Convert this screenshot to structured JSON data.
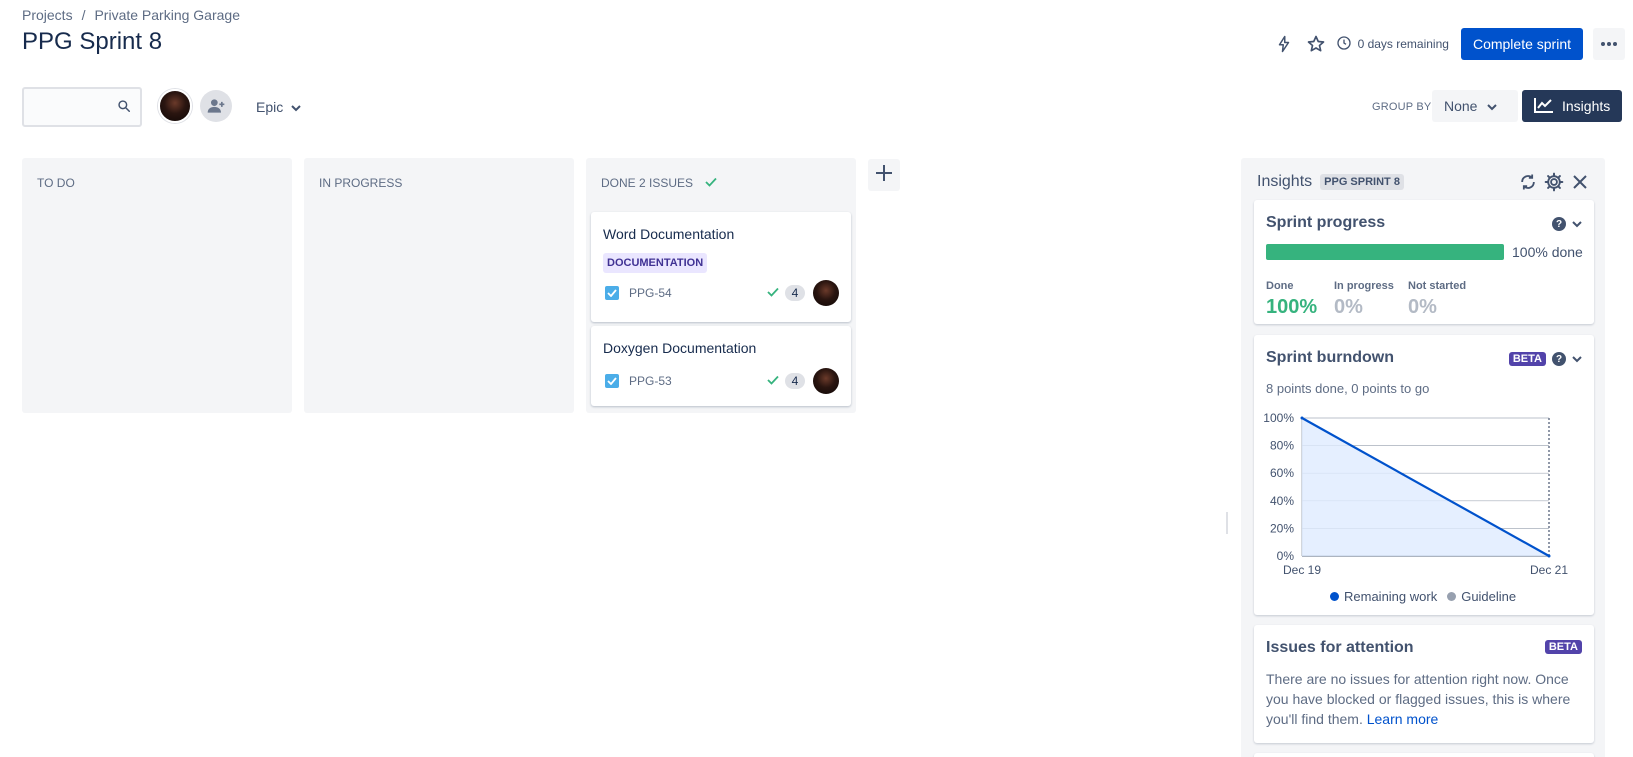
{
  "breadcrumb": {
    "root": "Projects",
    "separator": "/",
    "project": "Private Parking Garage"
  },
  "page_title": "PPG Sprint 8",
  "top_actions": {
    "remaining": "0 days remaining",
    "complete_sprint": "Complete sprint",
    "icons": [
      "lightning-icon",
      "star-icon",
      "clock-icon",
      "more-icon"
    ]
  },
  "toolbar": {
    "search_placeholder": "",
    "epic_filter": "Epic",
    "group_by_label": "GROUP BY",
    "group_by_value": "None",
    "insights_button": "Insights"
  },
  "columns": [
    {
      "title": "TO DO",
      "count_text": "",
      "cards": []
    },
    {
      "title": "IN PROGRESS",
      "count_text": "",
      "cards": []
    },
    {
      "title": "DONE",
      "count_text": "2 ISSUES",
      "cards": [
        {
          "title": "Word Documentation",
          "label": "DOCUMENTATION",
          "key": "PPG-54",
          "estimate": "4"
        },
        {
          "title": "Doxygen Documentation",
          "label": "",
          "key": "PPG-53",
          "estimate": "4"
        }
      ]
    }
  ],
  "insights": {
    "title": "Insights",
    "lozenge": "PPG SPRINT 8",
    "sprint_progress": {
      "title": "Sprint progress",
      "done_fraction": 1.0,
      "summary": "100% done",
      "stats": [
        {
          "label": "Done",
          "value": "100%",
          "color": "#36b37e"
        },
        {
          "label": "In progress",
          "value": "0%",
          "color": "#b3bac5"
        },
        {
          "label": "Not started",
          "value": "0%",
          "color": "#b3bac5"
        }
      ]
    },
    "burndown": {
      "title": "Sprint burndown",
      "badge": "BETA",
      "subtitle": "8 points done, 0 points to go",
      "legend": {
        "remaining": "Remaining work",
        "guideline": "Guideline"
      }
    },
    "attention": {
      "title": "Issues for attention",
      "badge": "BETA",
      "text": "There are no issues for attention right now. Once you have blocked or flagged issues, this is where you'll find them.",
      "link": "Learn more"
    }
  },
  "colors": {
    "primary": "#0052cc",
    "done_green": "#36b37e",
    "insights_dark": "#253858",
    "remaining_line": "#0052cc",
    "guideline": "#97a0af"
  },
  "chart_data": {
    "type": "line",
    "title": "Sprint burndown",
    "x": [
      "Dec 19",
      "Dec 21"
    ],
    "ylim": [
      0,
      100
    ],
    "yticks": [
      "0%",
      "20%",
      "40%",
      "60%",
      "80%",
      "100%"
    ],
    "xticks": [
      "Dec 19",
      "Dec 21"
    ],
    "series": [
      {
        "name": "Remaining work",
        "values": [
          100,
          0
        ]
      }
    ],
    "grid": true,
    "legend": "bottom"
  }
}
